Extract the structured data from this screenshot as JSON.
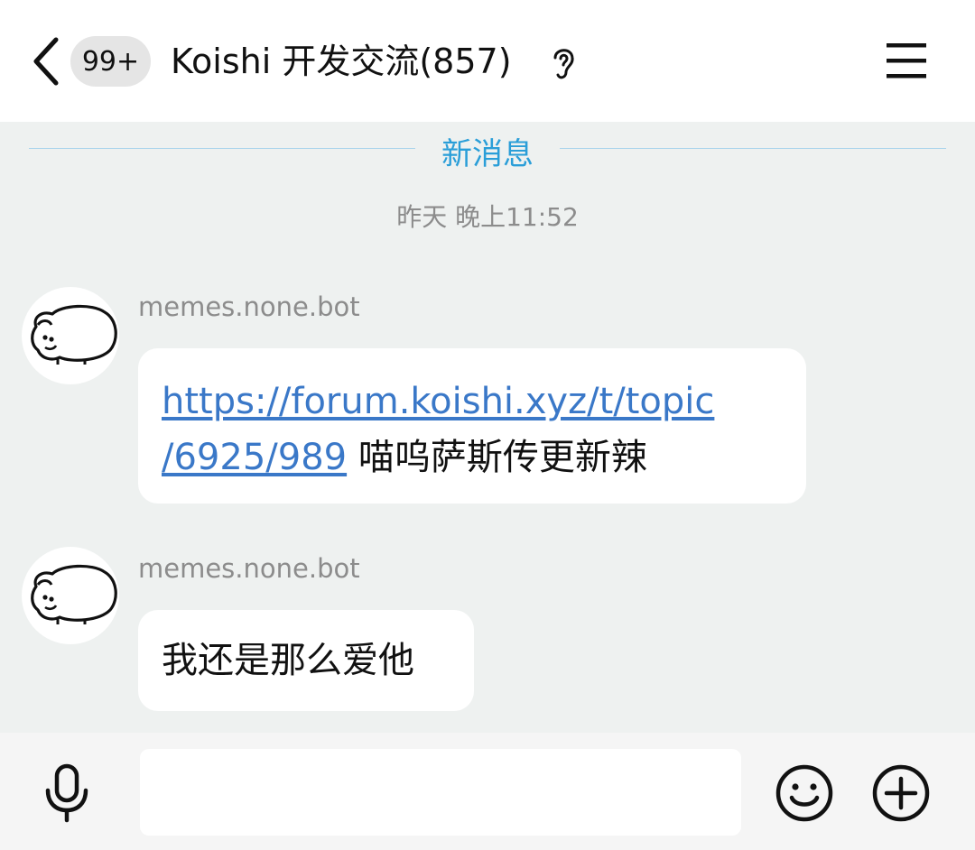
{
  "header": {
    "unread_badge": "99+",
    "title": "Koishi 开发交流(857)",
    "back_icon": "chevron-left-icon",
    "ear_icon": "ear-icon",
    "menu_icon": "hamburger-menu-icon"
  },
  "divider": {
    "label": "新消息",
    "color": "#2a9ed8"
  },
  "timestamp": "昨天 晚上11:52",
  "messages": [
    {
      "sender": "memes.none.bot",
      "avatar_icon": "cartoon-sheep-avatar",
      "link_line1": "https://forum.koishi.xyz/t/topic",
      "link_line2": "/6925/989",
      "text": " 喵呜萨斯传更新辣"
    },
    {
      "sender": "memes.none.bot",
      "avatar_icon": "cartoon-sheep-avatar",
      "text": "我还是那么爱他"
    }
  ],
  "input_bar": {
    "placeholder": "",
    "mic_icon": "microphone-icon",
    "emoji_icon": "smiley-icon",
    "plus_icon": "plus-circle-icon"
  },
  "colors": {
    "chat_background": "#eef1f0",
    "link": "#3a78c8",
    "meta_text": "#8c8c8c"
  }
}
